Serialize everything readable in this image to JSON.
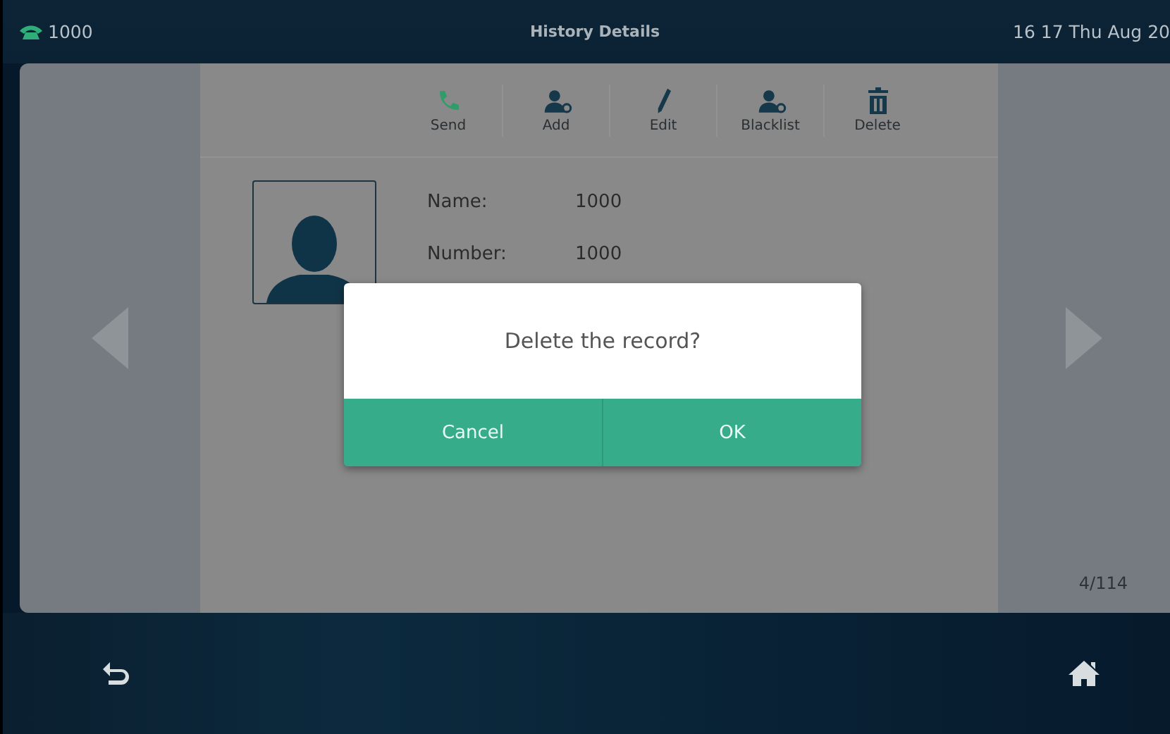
{
  "status_bar": {
    "line": "1000",
    "title": "History Details",
    "clock": "16 17 Thu Aug 20"
  },
  "toolbar": [
    {
      "label": "Send"
    },
    {
      "label": "Add"
    },
    {
      "label": "Edit"
    },
    {
      "label": "Blacklist"
    },
    {
      "label": "Delete"
    }
  ],
  "details": [
    {
      "label": "Name:",
      "value": "1000"
    },
    {
      "label": "Number:",
      "value": "1000"
    }
  ],
  "page_counter": "4/114",
  "dialog": {
    "message": "Delete the record?",
    "buttons": [
      "Cancel",
      "OK"
    ]
  }
}
